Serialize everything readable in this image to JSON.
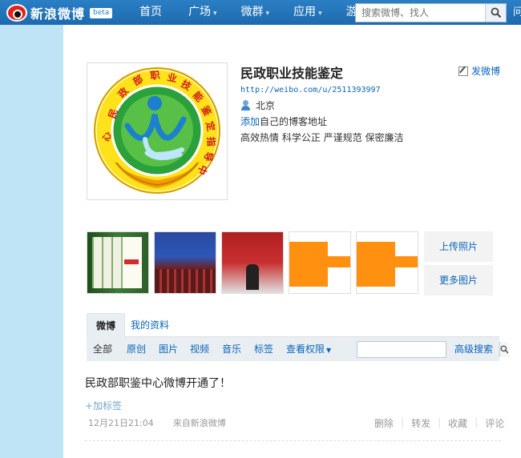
{
  "topnav": {
    "logo_text": "新浪微博",
    "beta": "beta",
    "items": [
      {
        "label": "首页",
        "caret": ""
      },
      {
        "label": "广场",
        "caret": "▾"
      },
      {
        "label": "微群",
        "caret": "▾"
      },
      {
        "label": "应用",
        "caret": "▾"
      },
      {
        "label": "游戏",
        "caret": "▾"
      }
    ],
    "search_placeholder": "搜索微博、找人",
    "right_text": "问"
  },
  "profile": {
    "name": "民政职业技能鉴定",
    "post_link": "发微博",
    "url": "http://weibo.com/u/2511393997",
    "location": "北京",
    "blog_link": "添加",
    "blog_text": "自己的博客地址",
    "description": "高效热情  科学公正  严谨规范  保密廉洁",
    "avatar_ring_text": "民政部职业技能鉴定指导中心"
  },
  "photos": {
    "thumbs": [
      "books",
      "hall",
      "stage",
      "orange-placeholder",
      "orange-placeholder"
    ],
    "upload": "上传照片",
    "more": "更多图片"
  },
  "tabs": {
    "active": "微博",
    "other": "我的资料"
  },
  "filters": {
    "items": [
      "全部",
      "原创",
      "图片",
      "视频",
      "音乐",
      "标签"
    ],
    "dropdown": "查看权限",
    "advanced": "高级搜索"
  },
  "post": {
    "text": "民政部职鉴中心微博开通了！",
    "add_tag": "+加标签",
    "time": "12月21日21:04",
    "source": "来自新浪微博",
    "actions": [
      "删除",
      "转发",
      "收藏",
      "评论"
    ]
  },
  "colors": {
    "nav_blue": "#1d6aae",
    "link_blue": "#0a66b8",
    "bg": "#bfe4f6",
    "logo_green": "#2aa13a",
    "logo_yellow": "#ffe21a",
    "orange": "#ff9010"
  }
}
